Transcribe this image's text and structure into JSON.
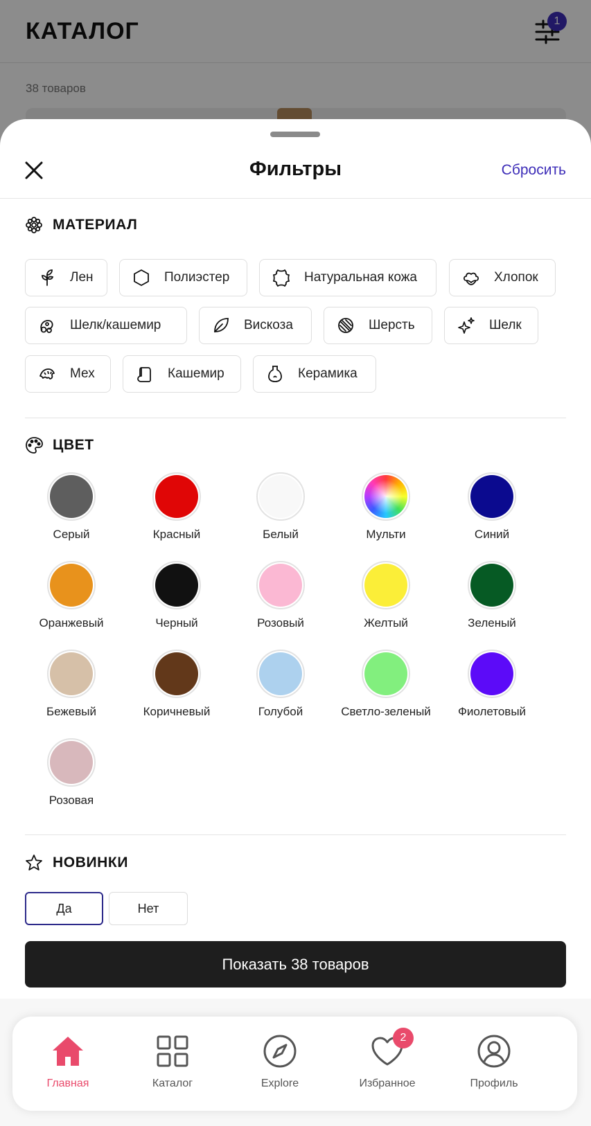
{
  "background": {
    "title": "КАТАЛОГ",
    "filter_badge": "1",
    "count": "38 товаров"
  },
  "sheet": {
    "title": "Фильтры",
    "reset": "Сбросить"
  },
  "material": {
    "title": "МАТЕРИАЛ",
    "icon": "flower-icon",
    "chips": [
      {
        "label": "Лен",
        "icon": "plant-icon"
      },
      {
        "label": "Полиэстер",
        "icon": "hexagon-icon"
      },
      {
        "label": "Натуральная кожа",
        "icon": "leather-icon"
      },
      {
        "label": "Хлопок",
        "icon": "cotton-icon"
      },
      {
        "label": "Шелк/кашемир",
        "icon": "silk-cashmere-icon"
      },
      {
        "label": "Вискоза",
        "icon": "leaf-icon"
      },
      {
        "label": "Шерсть",
        "icon": "wool-icon"
      },
      {
        "label": "Шелк",
        "icon": "sparkles-icon"
      },
      {
        "label": "Мех",
        "icon": "fur-icon"
      },
      {
        "label": "Кашемир",
        "icon": "cashmere-icon"
      },
      {
        "label": "Керамика",
        "icon": "vase-icon"
      }
    ]
  },
  "color": {
    "title": "ЦВЕТ",
    "icon": "palette-icon",
    "swatches": [
      {
        "label": "Серый",
        "color": "#5e5e5e"
      },
      {
        "label": "Красный",
        "color": "#e00606"
      },
      {
        "label": "Белый",
        "color": "#f8f8f8"
      },
      {
        "label": "Мульти",
        "color": "multi"
      },
      {
        "label": "Синий",
        "color": "#0b0a8f"
      },
      {
        "label": "Оранжевый",
        "color": "#e8921c"
      },
      {
        "label": "Черный",
        "color": "#111111"
      },
      {
        "label": "Розовый",
        "color": "#fbb8d3"
      },
      {
        "label": "Желтый",
        "color": "#fbee38"
      },
      {
        "label": "Зеленый",
        "color": "#065a24"
      },
      {
        "label": "Бежевый",
        "color": "#d6c0a8"
      },
      {
        "label": "Коричневый",
        "color": "#62381a"
      },
      {
        "label": "Голубой",
        "color": "#add1ee"
      },
      {
        "label": "Светло-зеленый",
        "color": "#82ef7e"
      },
      {
        "label": "Фиолетовый",
        "color": "#5c0bf8"
      },
      {
        "label": "Розовая",
        "color": "#d8b8bc"
      }
    ]
  },
  "novelties": {
    "title": "НОВИНКИ",
    "icon": "star-icon",
    "yes": "Да",
    "no": "Нет",
    "selected": "Да"
  },
  "show_button": "Показать 38 товаров",
  "nav": {
    "items": [
      {
        "label": "Главная",
        "icon": "home-icon",
        "active": true
      },
      {
        "label": "Каталог",
        "icon": "grid-icon"
      },
      {
        "label": "Explore",
        "icon": "compass-icon"
      },
      {
        "label": "Избранное",
        "icon": "heart-icon",
        "badge": "2"
      },
      {
        "label": "Профиль",
        "icon": "profile-icon"
      }
    ]
  },
  "colors": {
    "accent": "#3d2db8",
    "nav_active": "#e94a6b",
    "button_dark": "#1e1e1e"
  }
}
